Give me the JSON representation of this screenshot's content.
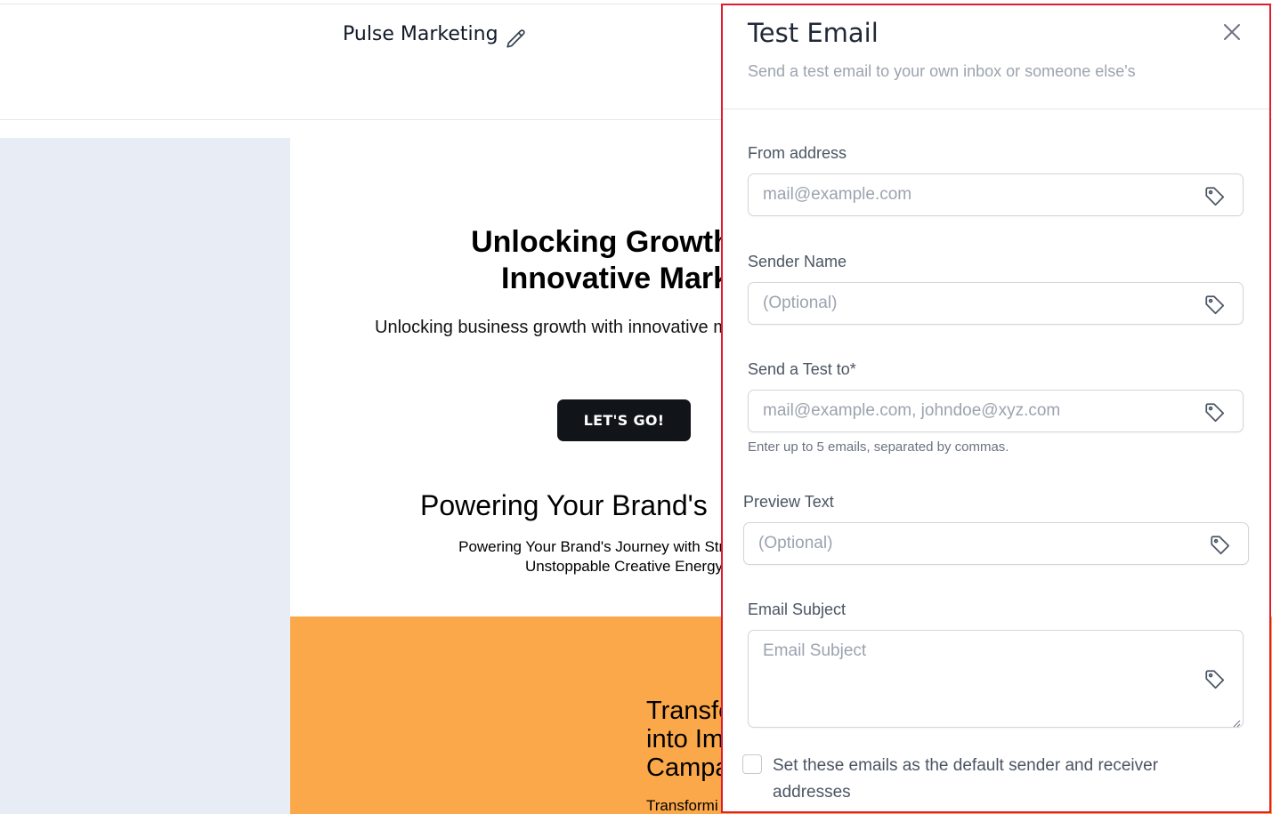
{
  "editor": {
    "doc_title": "Pulse Marketing",
    "edit_icon": "pencil-icon"
  },
  "email_preview": {
    "hero_heading_line1": "Unlocking Growth Th",
    "hero_heading_line2": "Innovative Marke",
    "hero_subtext": "Unlocking business growth with innovative m",
    "cta_label": "LET'S GO!",
    "section_heading": "Powering Your Brand's",
    "section_text_line1": "Powering Your Brand's Journey with Strategic Ma",
    "section_text_line2": "Unstoppable Creative Energy",
    "orange_heading_line1": "Transfo",
    "orange_heading_line2": "into Im",
    "orange_heading_line3": "Campa",
    "orange_text": "Transformi",
    "orange_color": "#fba84a"
  },
  "drawer": {
    "title": "Test Email",
    "subtitle": "Send a test email to your own inbox or someone else's",
    "close_icon": "close-icon",
    "border_color": "#e11d2e",
    "fields": {
      "from_address": {
        "label": "From address",
        "placeholder": "mail@example.com",
        "value": ""
      },
      "sender_name": {
        "label": "Sender Name",
        "placeholder": "(Optional)",
        "value": ""
      },
      "send_test_to": {
        "label": "Send a Test to*",
        "placeholder": "mail@example.com, johndoe@xyz.com",
        "value": "",
        "hint": "Enter up to 5 emails, separated by commas."
      },
      "preview_text": {
        "label": "Preview Text",
        "placeholder": "(Optional)",
        "value": ""
      },
      "email_subject": {
        "label": "Email Subject",
        "placeholder": "Email Subject",
        "value": ""
      }
    },
    "field_icon": "tag-icon",
    "default_checkbox": {
      "label": "Set these emails as the default sender and receiver addresses",
      "checked": false
    }
  }
}
